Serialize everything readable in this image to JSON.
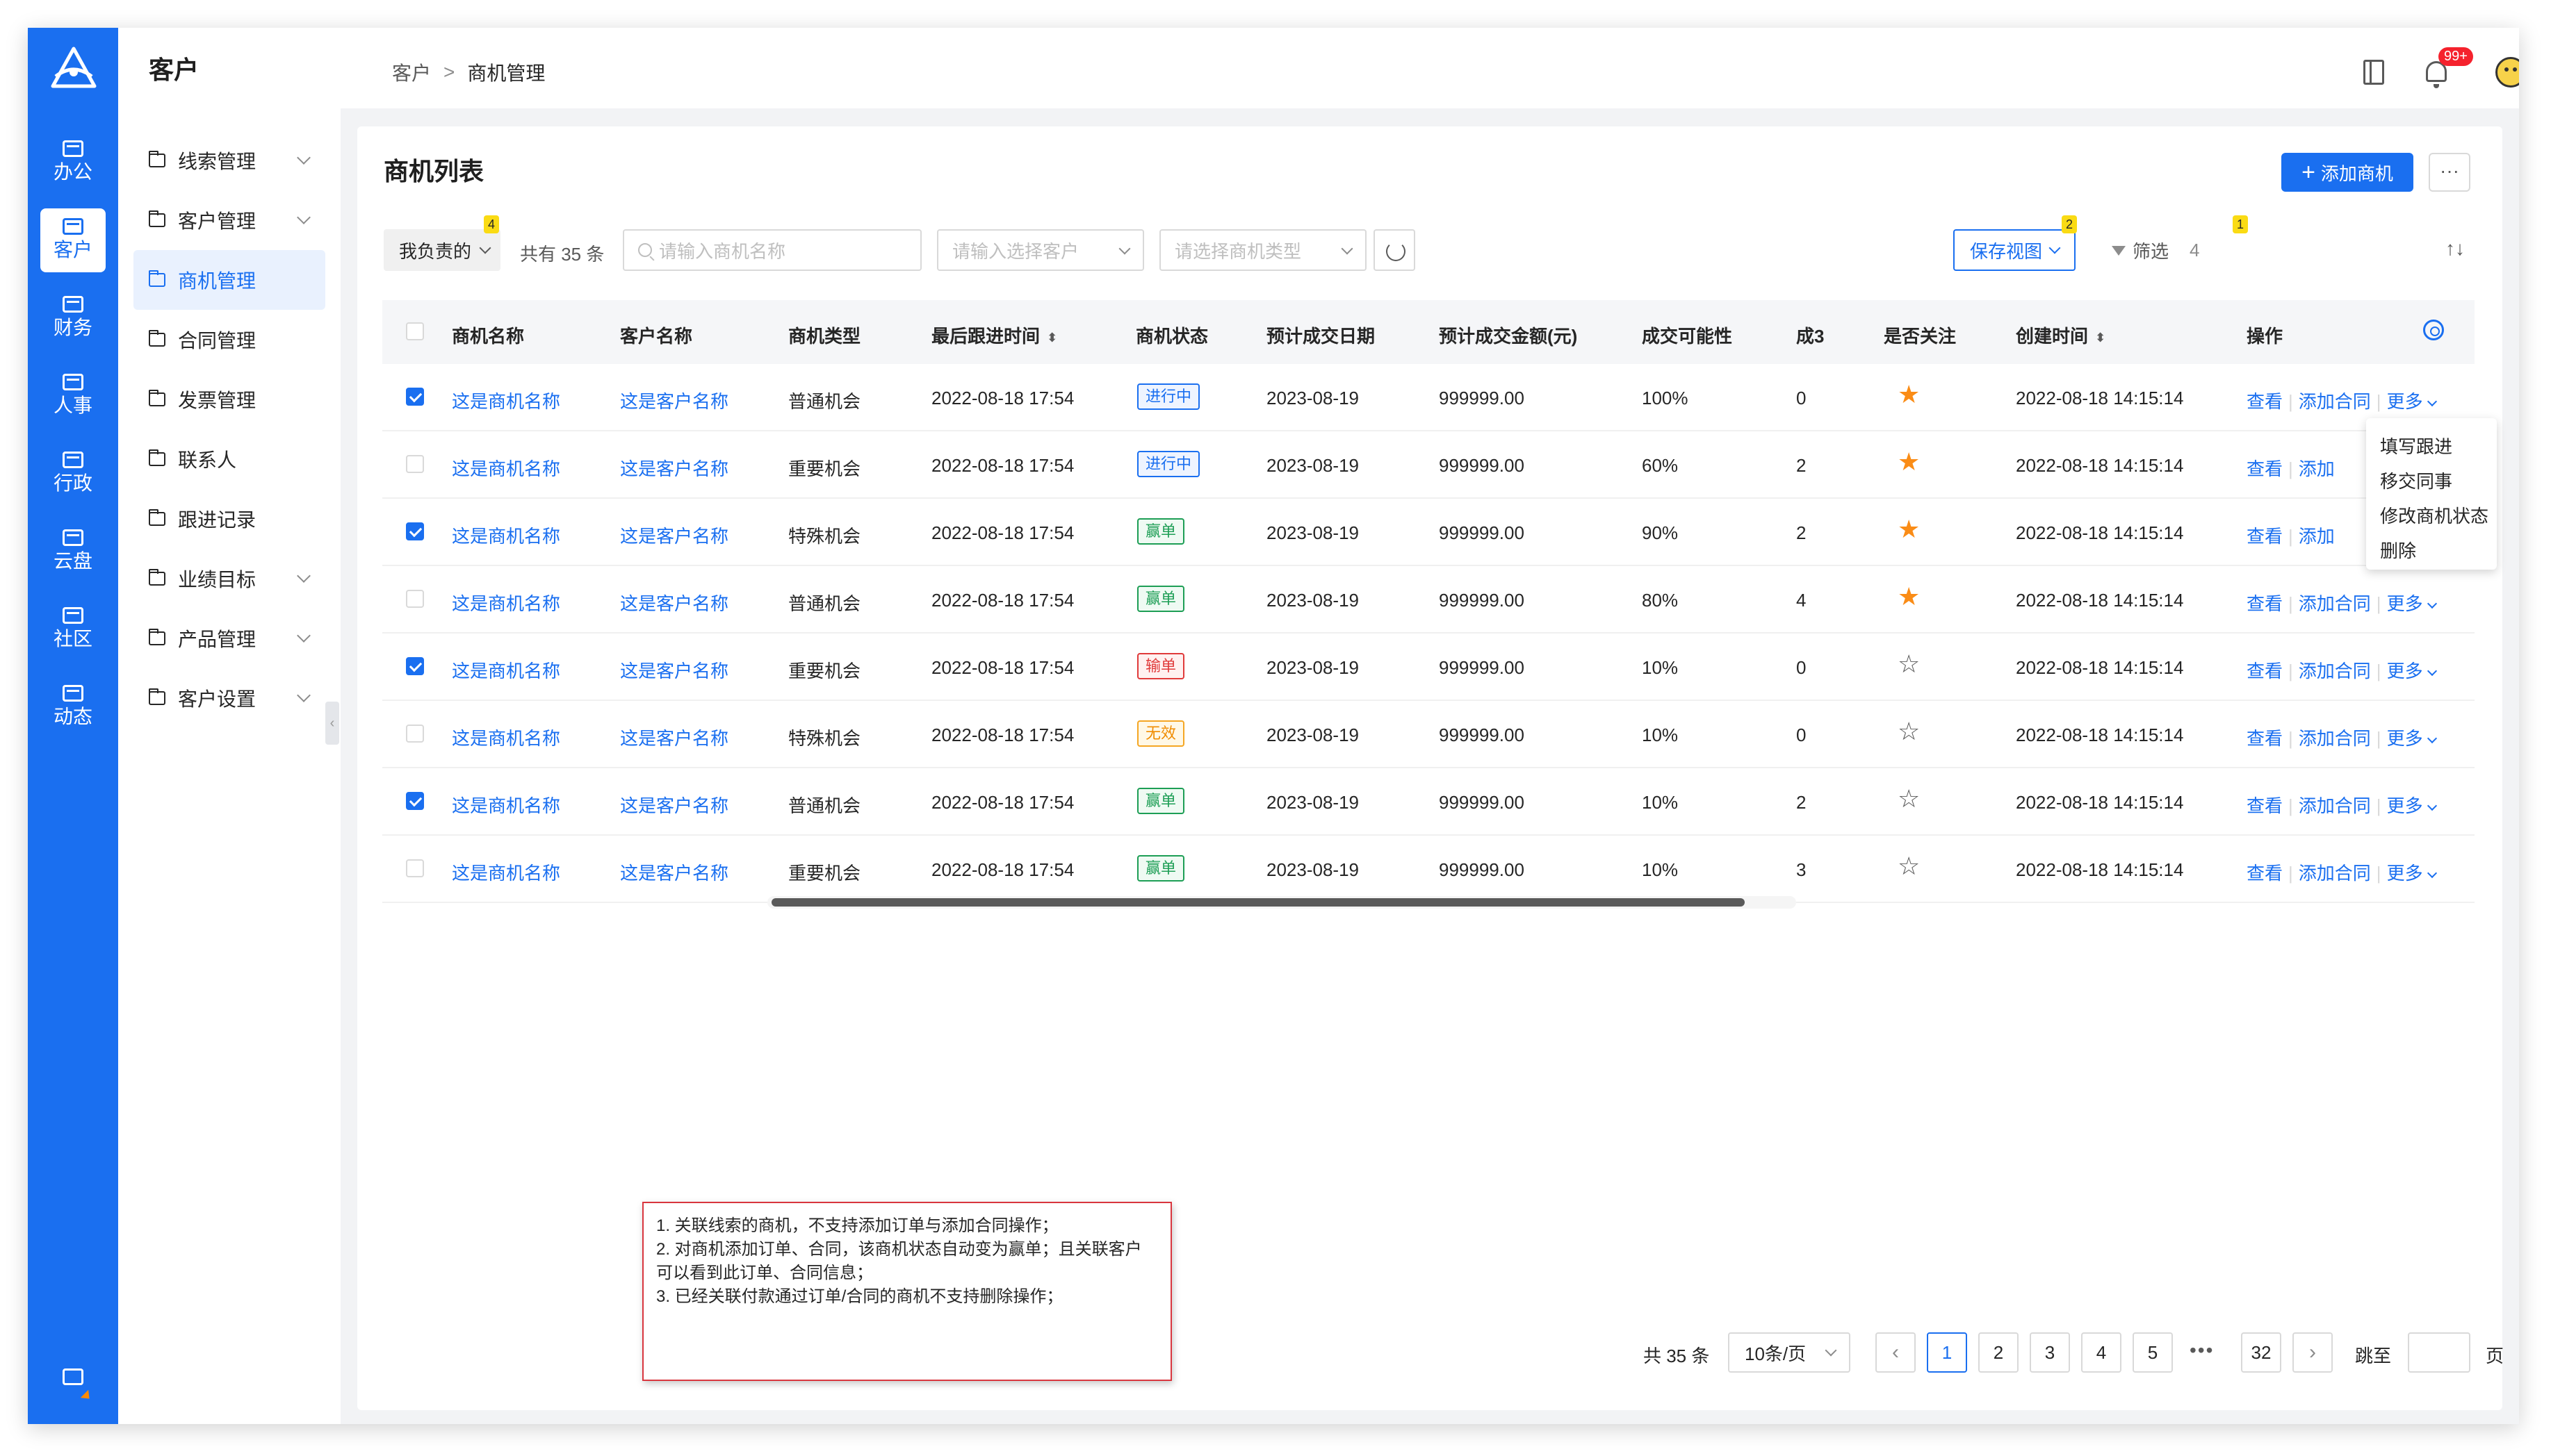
{
  "rail": {
    "items": [
      {
        "label": "办公",
        "active": false
      },
      {
        "label": "客户",
        "active": true
      },
      {
        "label": "财务",
        "active": false
      },
      {
        "label": "人事",
        "active": false
      },
      {
        "label": "行政",
        "active": false
      },
      {
        "label": "云盘",
        "active": false
      },
      {
        "label": "社区",
        "active": false
      },
      {
        "label": "动态",
        "active": false
      }
    ]
  },
  "sidebar": {
    "title": "客户",
    "items": [
      {
        "label": "线索管理",
        "expandable": true
      },
      {
        "label": "客户管理",
        "expandable": true
      },
      {
        "label": "商机管理",
        "active": true
      },
      {
        "label": "合同管理"
      },
      {
        "label": "发票管理"
      },
      {
        "label": "联系人"
      },
      {
        "label": "跟进记录"
      },
      {
        "label": "业绩目标",
        "expandable": true
      },
      {
        "label": "产品管理",
        "expandable": true
      },
      {
        "label": "客户设置",
        "expandable": true
      }
    ]
  },
  "header": {
    "breadcrumb": [
      "客户",
      "商机管理"
    ],
    "separator": ">",
    "notification_badge": "99+"
  },
  "main": {
    "title": "商机列表",
    "add_button": "添加商机",
    "more_button": "···",
    "filters": {
      "mine": "我负责的",
      "mine_badge": "4",
      "total_text": "共有 35 条",
      "search_placeholder": "请输入商机名称",
      "customer_placeholder": "请输入选择客户",
      "type_placeholder": "请选择商机类型",
      "save_view": "保存视图",
      "save_view_badge": "2",
      "filter_label": "筛选",
      "filter_count": "4",
      "filter_badge": "1",
      "sort_icon": "↑↓"
    },
    "columns": [
      "商机名称",
      "客户名称",
      "商机类型",
      "最后跟进时间",
      "商机状态",
      "预计成交日期",
      "预计成交金额(元)",
      "成交可能性",
      "成3",
      "是否关注",
      "创建时间",
      "操作"
    ],
    "rows": [
      {
        "checked": true,
        "name": "这是商机名称",
        "customer": "这是客户名称",
        "type": "普通机会",
        "last": "2022-08-18 17:54",
        "status": "进行中",
        "status_color": "blue",
        "date": "2023-08-19",
        "amount": "999999.00",
        "prob": "100%",
        "count": "0",
        "star": true,
        "created": "2022-08-18 14:15:14"
      },
      {
        "checked": false,
        "name": "这是商机名称",
        "customer": "这是客户名称",
        "type": "重要机会",
        "last": "2022-08-18 17:54",
        "status": "进行中",
        "status_color": "blue",
        "date": "2023-08-19",
        "amount": "999999.00",
        "prob": "60%",
        "count": "2",
        "star": true,
        "created": "2022-08-18 14:15:14"
      },
      {
        "checked": true,
        "name": "这是商机名称",
        "customer": "这是客户名称",
        "type": "特殊机会",
        "last": "2022-08-18 17:54",
        "status": "赢单",
        "status_color": "green",
        "date": "2023-08-19",
        "amount": "999999.00",
        "prob": "90%",
        "count": "2",
        "star": true,
        "created": "2022-08-18 14:15:14"
      },
      {
        "checked": false,
        "name": "这是商机名称",
        "customer": "这是客户名称",
        "type": "普通机会",
        "last": "2022-08-18 17:54",
        "status": "赢单",
        "status_color": "green",
        "date": "2023-08-19",
        "amount": "999999.00",
        "prob": "80%",
        "count": "4",
        "star": true,
        "created": "2022-08-18 14:15:14"
      },
      {
        "checked": true,
        "name": "这是商机名称",
        "customer": "这是客户名称",
        "type": "重要机会",
        "last": "2022-08-18 17:54",
        "status": "输单",
        "status_color": "red",
        "date": "2023-08-19",
        "amount": "999999.00",
        "prob": "10%",
        "count": "0",
        "star": false,
        "created": "2022-08-18 14:15:14"
      },
      {
        "checked": false,
        "name": "这是商机名称",
        "customer": "这是客户名称",
        "type": "特殊机会",
        "last": "2022-08-18 17:54",
        "status": "无效",
        "status_color": "orange",
        "date": "2023-08-19",
        "amount": "999999.00",
        "prob": "10%",
        "count": "0",
        "star": false,
        "created": "2022-08-18 14:15:14"
      },
      {
        "checked": true,
        "name": "这是商机名称",
        "customer": "这是客户名称",
        "type": "普通机会",
        "last": "2022-08-18 17:54",
        "status": "赢单",
        "status_color": "green",
        "date": "2023-08-19",
        "amount": "999999.00",
        "prob": "10%",
        "count": "2",
        "star": false,
        "created": "2022-08-18 14:15:14"
      },
      {
        "checked": false,
        "name": "这是商机名称",
        "customer": "这是客户名称",
        "type": "重要机会",
        "last": "2022-08-18 17:54",
        "status": "赢单",
        "status_color": "green",
        "date": "2023-08-19",
        "amount": "999999.00",
        "prob": "10%",
        "count": "3",
        "star": false,
        "created": "2022-08-18 14:15:14"
      }
    ],
    "ops": {
      "view": "查看",
      "add_contract": "添加合同",
      "add_contract_short": "添加",
      "more": "更多"
    },
    "more_menu": [
      "填写跟进",
      "移交同事",
      "修改商机状态",
      "删除"
    ],
    "note": [
      "1. 关联线索的商机，不支持添加订单与添加合同操作；",
      "2. 对商机添加订单、合同，该商机状态自动变为赢单；且关联客户可以看到此订单、合同信息；",
      "3. 已经关联付款通过订单/合同的商机不支持删除操作；"
    ],
    "pagination": {
      "total": "共 35 条",
      "page_size": "10条/页",
      "prev": "‹",
      "pages": [
        "1",
        "2",
        "3",
        "4",
        "5"
      ],
      "dots": "•••",
      "last_page": "32",
      "next": "›",
      "current": "1",
      "jump_label": "跳至",
      "page_label": "页"
    }
  },
  "colors": {
    "primary": "#1a6ff0",
    "star": "#fa8c16",
    "win": "#1d9e55",
    "lose": "#e03a3a",
    "invalid": "#f08c00"
  }
}
